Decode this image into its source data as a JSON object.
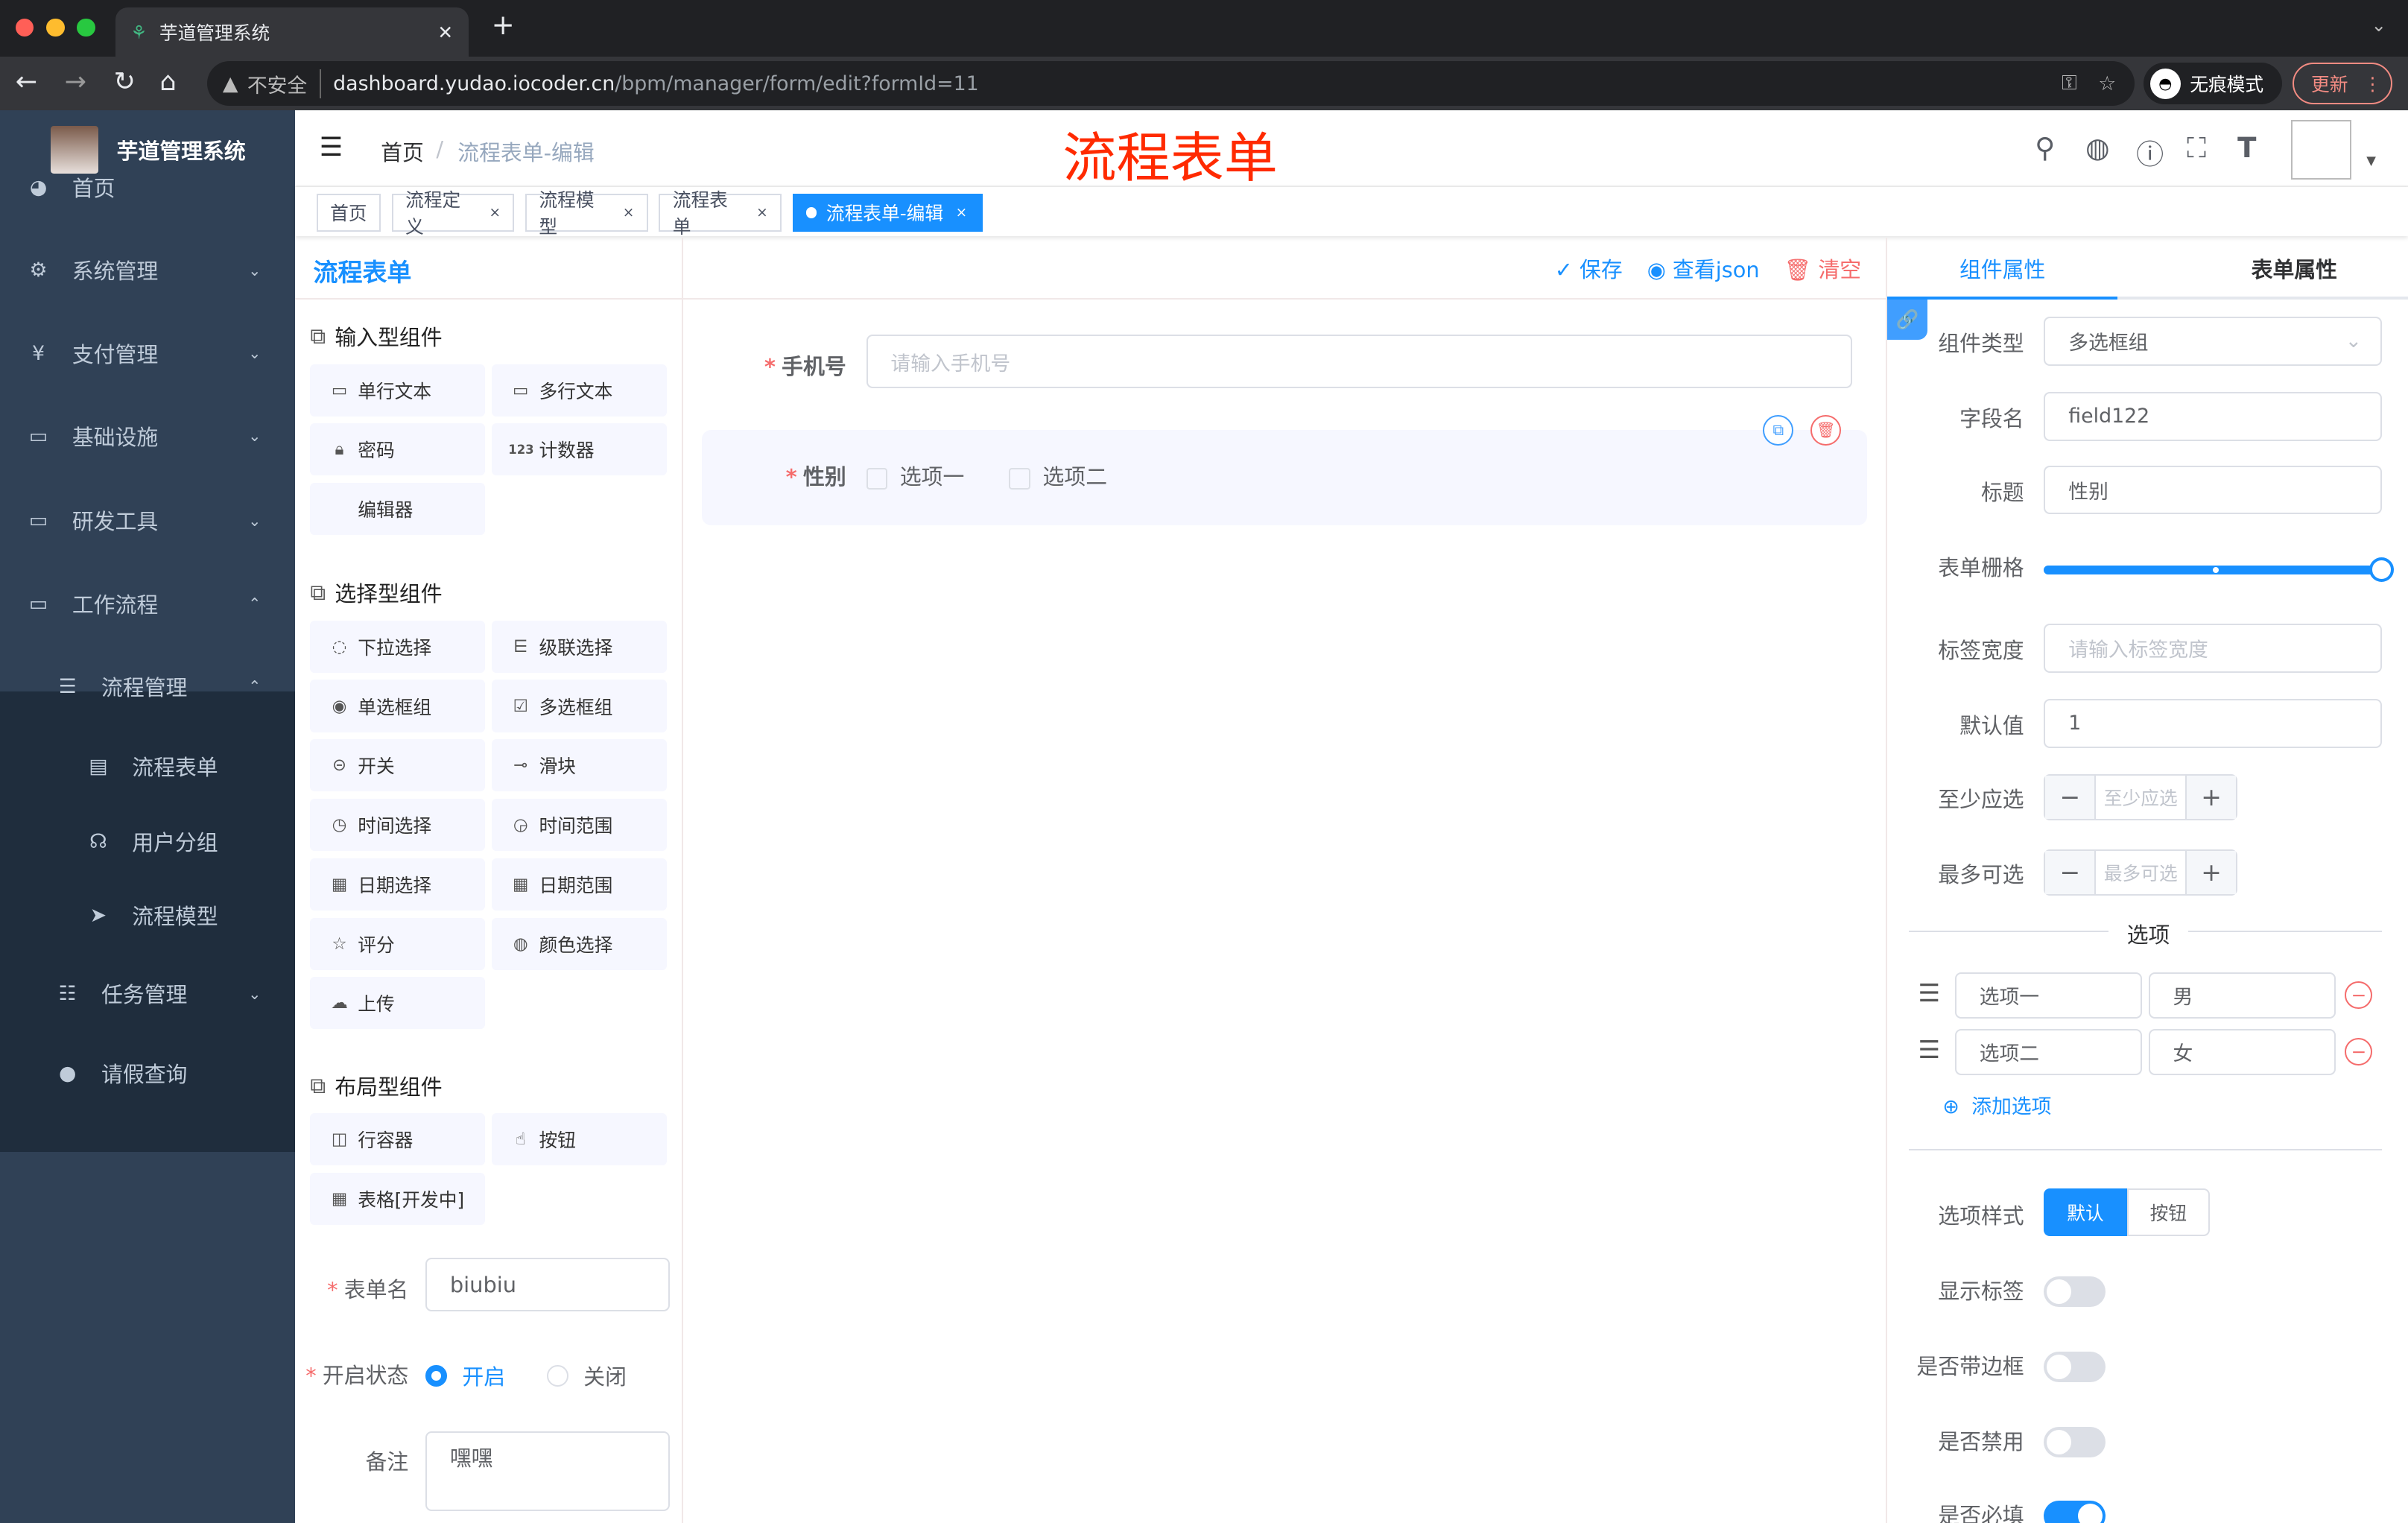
{
  "browser": {
    "tab_title": "芋道管理系统",
    "new_tab": "+",
    "insecure": "不安全",
    "url_host": "dashboard.yudao.iocoder.cn",
    "url_path": "/bpm/manager/form/edit?formId=11",
    "incognito": "无痕模式",
    "update": "更新"
  },
  "sidebar": {
    "brand": "芋道管理系统",
    "items": [
      {
        "label": "首页",
        "icon": "dashboard-icon"
      },
      {
        "label": "系统管理",
        "icon": "gear-icon"
      },
      {
        "label": "支付管理",
        "icon": "yen-icon"
      },
      {
        "label": "基础设施",
        "icon": "monitor-icon"
      },
      {
        "label": "研发工具",
        "icon": "toolbox-icon"
      },
      {
        "label": "工作流程",
        "icon": "toolbox-icon"
      },
      {
        "label": "流程管理",
        "icon": "list-icon"
      },
      {
        "label": "流程表单",
        "icon": "form-icon"
      },
      {
        "label": "用户分组",
        "icon": "group-icon"
      },
      {
        "label": "流程模型",
        "icon": "send-icon"
      },
      {
        "label": "任务管理",
        "icon": "tree-icon"
      },
      {
        "label": "请假查询",
        "icon": "user-icon"
      }
    ]
  },
  "header": {
    "breadcrumb": [
      "首页",
      "流程表单-编辑"
    ],
    "watermark_title": "流程表单",
    "colors": {
      "accent": "#1890ff",
      "sidebar": "#304156",
      "title_red": "#ff2a00"
    }
  },
  "tags": [
    {
      "label": "首页"
    },
    {
      "label": "流程定义"
    },
    {
      "label": "流程模型"
    },
    {
      "label": "流程表单"
    },
    {
      "label": "流程表单-编辑",
      "active": true
    }
  ],
  "left_panel": {
    "title": "流程表单",
    "groups": [
      {
        "title": "输入型组件",
        "items": [
          {
            "label": "单行文本",
            "icon": "input-icon"
          },
          {
            "label": "多行文本",
            "icon": "textarea-icon"
          },
          {
            "label": "密码",
            "icon": "lock-icon"
          },
          {
            "label": "计数器",
            "icon": "number-icon"
          },
          {
            "label": "编辑器",
            "icon": ""
          }
        ]
      },
      {
        "title": "选择型组件",
        "items": [
          {
            "label": "下拉选择",
            "icon": "select-icon"
          },
          {
            "label": "级联选择",
            "icon": "cascader-icon"
          },
          {
            "label": "单选框组",
            "icon": "radio-icon"
          },
          {
            "label": "多选框组",
            "icon": "checkbox-icon"
          },
          {
            "label": "开关",
            "icon": "switch-icon"
          },
          {
            "label": "滑块",
            "icon": "slider-icon"
          },
          {
            "label": "时间选择",
            "icon": "clock-icon"
          },
          {
            "label": "时间范围",
            "icon": "time-range-icon"
          },
          {
            "label": "日期选择",
            "icon": "calendar-icon"
          },
          {
            "label": "日期范围",
            "icon": "date-range-icon"
          },
          {
            "label": "评分",
            "icon": "star-icon"
          },
          {
            "label": "颜色选择",
            "icon": "palette-icon"
          },
          {
            "label": "上传",
            "icon": "upload-icon"
          }
        ]
      },
      {
        "title": "布局型组件",
        "items": [
          {
            "label": "行容器",
            "icon": "row-icon"
          },
          {
            "label": "按钮",
            "icon": "hand-icon"
          },
          {
            "label": "表格[开发中]",
            "icon": "table-icon"
          }
        ]
      }
    ],
    "form_name_label": "表单名",
    "form_name": "biubiu",
    "status_label": "开启状态",
    "status_on": "开启",
    "status_off": "关闭",
    "status_value": "开启",
    "remark_label": "备注",
    "remark": "嘿嘿"
  },
  "canvas": {
    "actions": {
      "save": "保存",
      "json": "查看json",
      "clear": "清空"
    },
    "phone_label": "手机号",
    "phone_placeholder": "请输入手机号",
    "gender_label": "性别",
    "options": [
      "选项一",
      "选项二"
    ]
  },
  "right_panel": {
    "tabs": [
      "组件属性",
      "表单属性"
    ],
    "type_label": "组件类型",
    "type_value": "多选框组",
    "field_label": "字段名",
    "field_value": "field122",
    "title_label": "标题",
    "title_value": "性别",
    "grid_label": "表单栅格",
    "grid_value": 24,
    "grid_max": 24,
    "label_width_label": "标签宽度",
    "label_width_placeholder": "请输入标签宽度",
    "default_label": "默认值",
    "default_value": "1",
    "min_label": "至少应选",
    "min_placeholder": "至少应选",
    "max_label": "最多可选",
    "max_placeholder": "最多可选",
    "options_title": "选项",
    "options": [
      {
        "label": "选项一",
        "value": "男"
      },
      {
        "label": "选项二",
        "value": "女"
      }
    ],
    "add_option": "添加选项",
    "style_label": "选项样式",
    "style_default": "默认",
    "style_button": "按钮",
    "show_label": "显示标签",
    "show_label_on": true,
    "border_label": "是否带边框",
    "border_on": false,
    "disabled_label": "是否禁用",
    "disabled_on": false,
    "required_label": "是否必填",
    "required_on": true
  }
}
